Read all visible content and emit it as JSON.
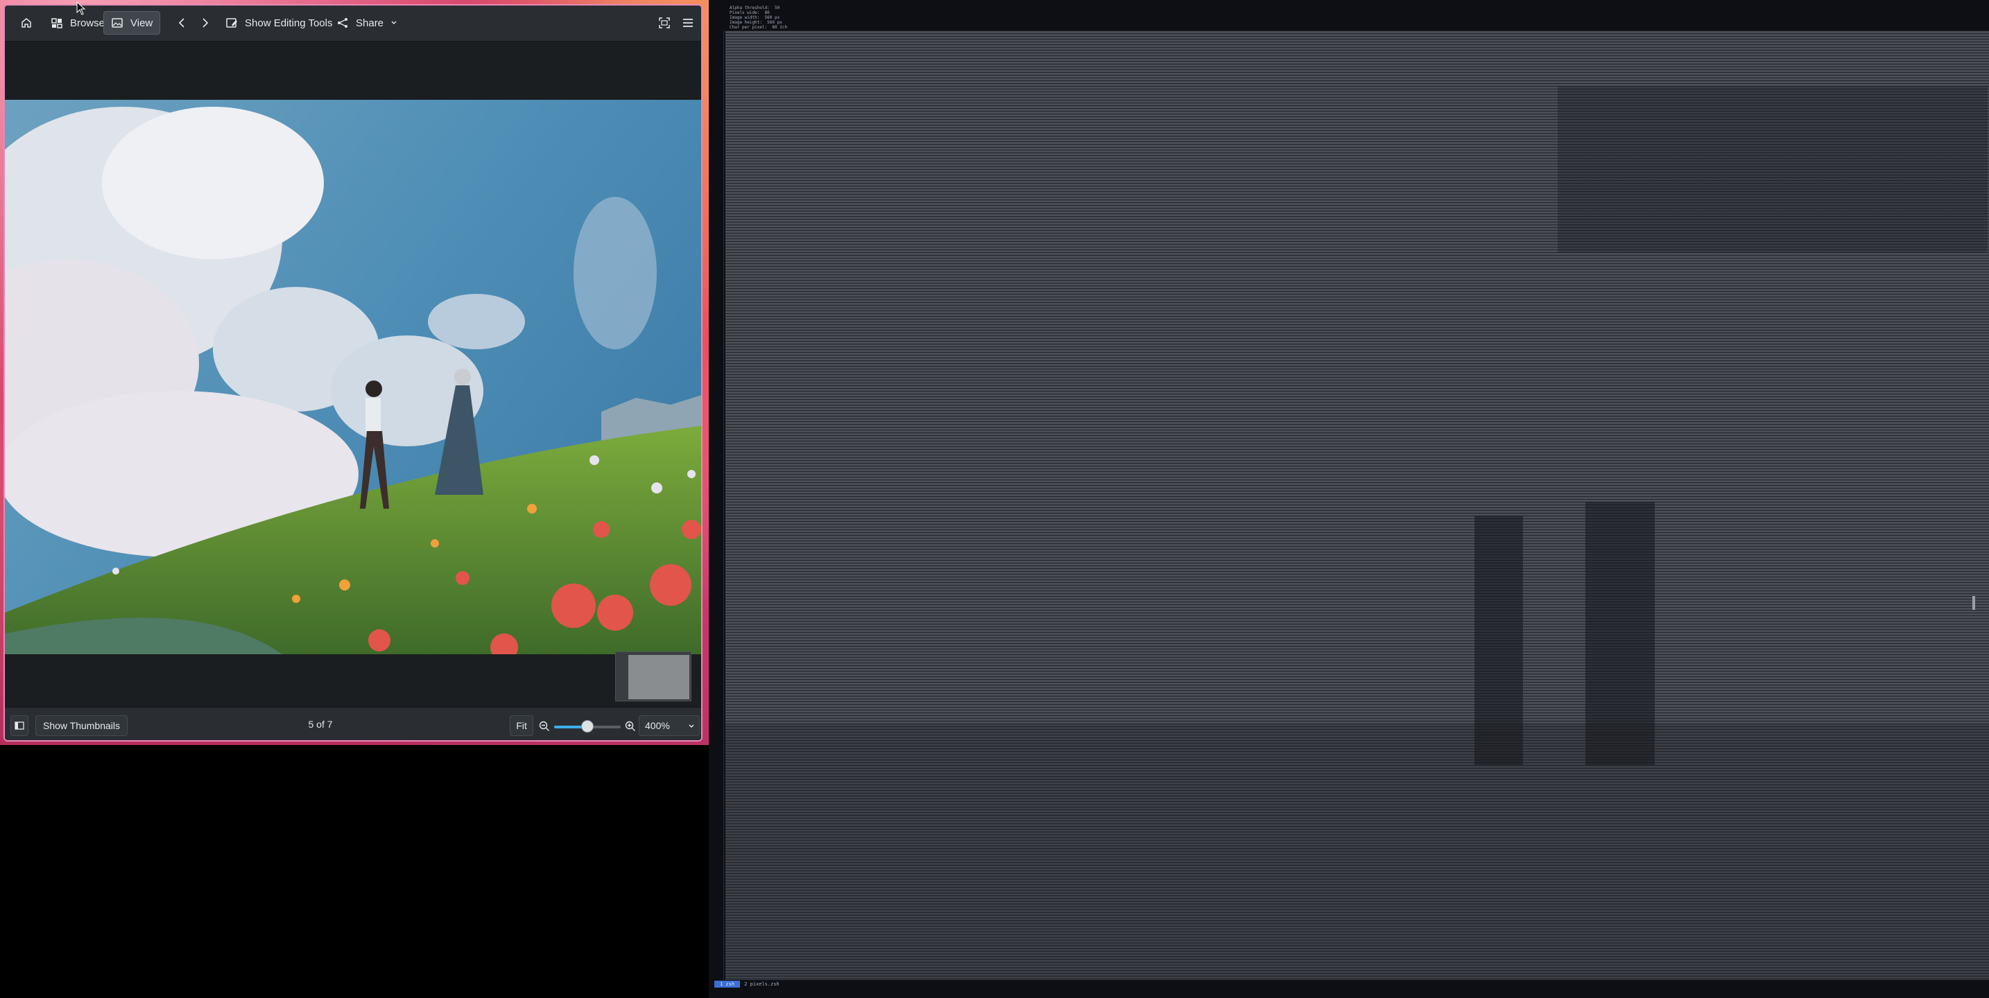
{
  "viewer": {
    "toolbar": {
      "home_icon": "home-icon",
      "browse_label": "Browse",
      "view_label": "View",
      "prev_icon": "chevron-left-icon",
      "next_icon": "chevron-right-icon",
      "editing_label": "Show Editing Tools",
      "share_label": "Share",
      "fullscreen_icon": "fullscreen-icon",
      "menu_icon": "hamburger-menu-icon"
    },
    "statusbar": {
      "thumbnails_label": "Show Thumbnails",
      "page_counter": "5 of 7",
      "fit_label": "Fit",
      "zoom_value": "400%",
      "zoom_slider_fraction": 0.5
    },
    "accent_color": "#3daee9",
    "window_border_color": "#e48ab7"
  },
  "terminal": {
    "info_lines": [
      "Alpha threshold:  50",
      "Pixels wide:  80",
      "Image width:  560 px",
      "Image height:  560 px",
      "Char per pixel:  80 2ch"
    ],
    "status_tab_active": "1 zsh",
    "status_tab_2": "2 pixels.zsh"
  }
}
